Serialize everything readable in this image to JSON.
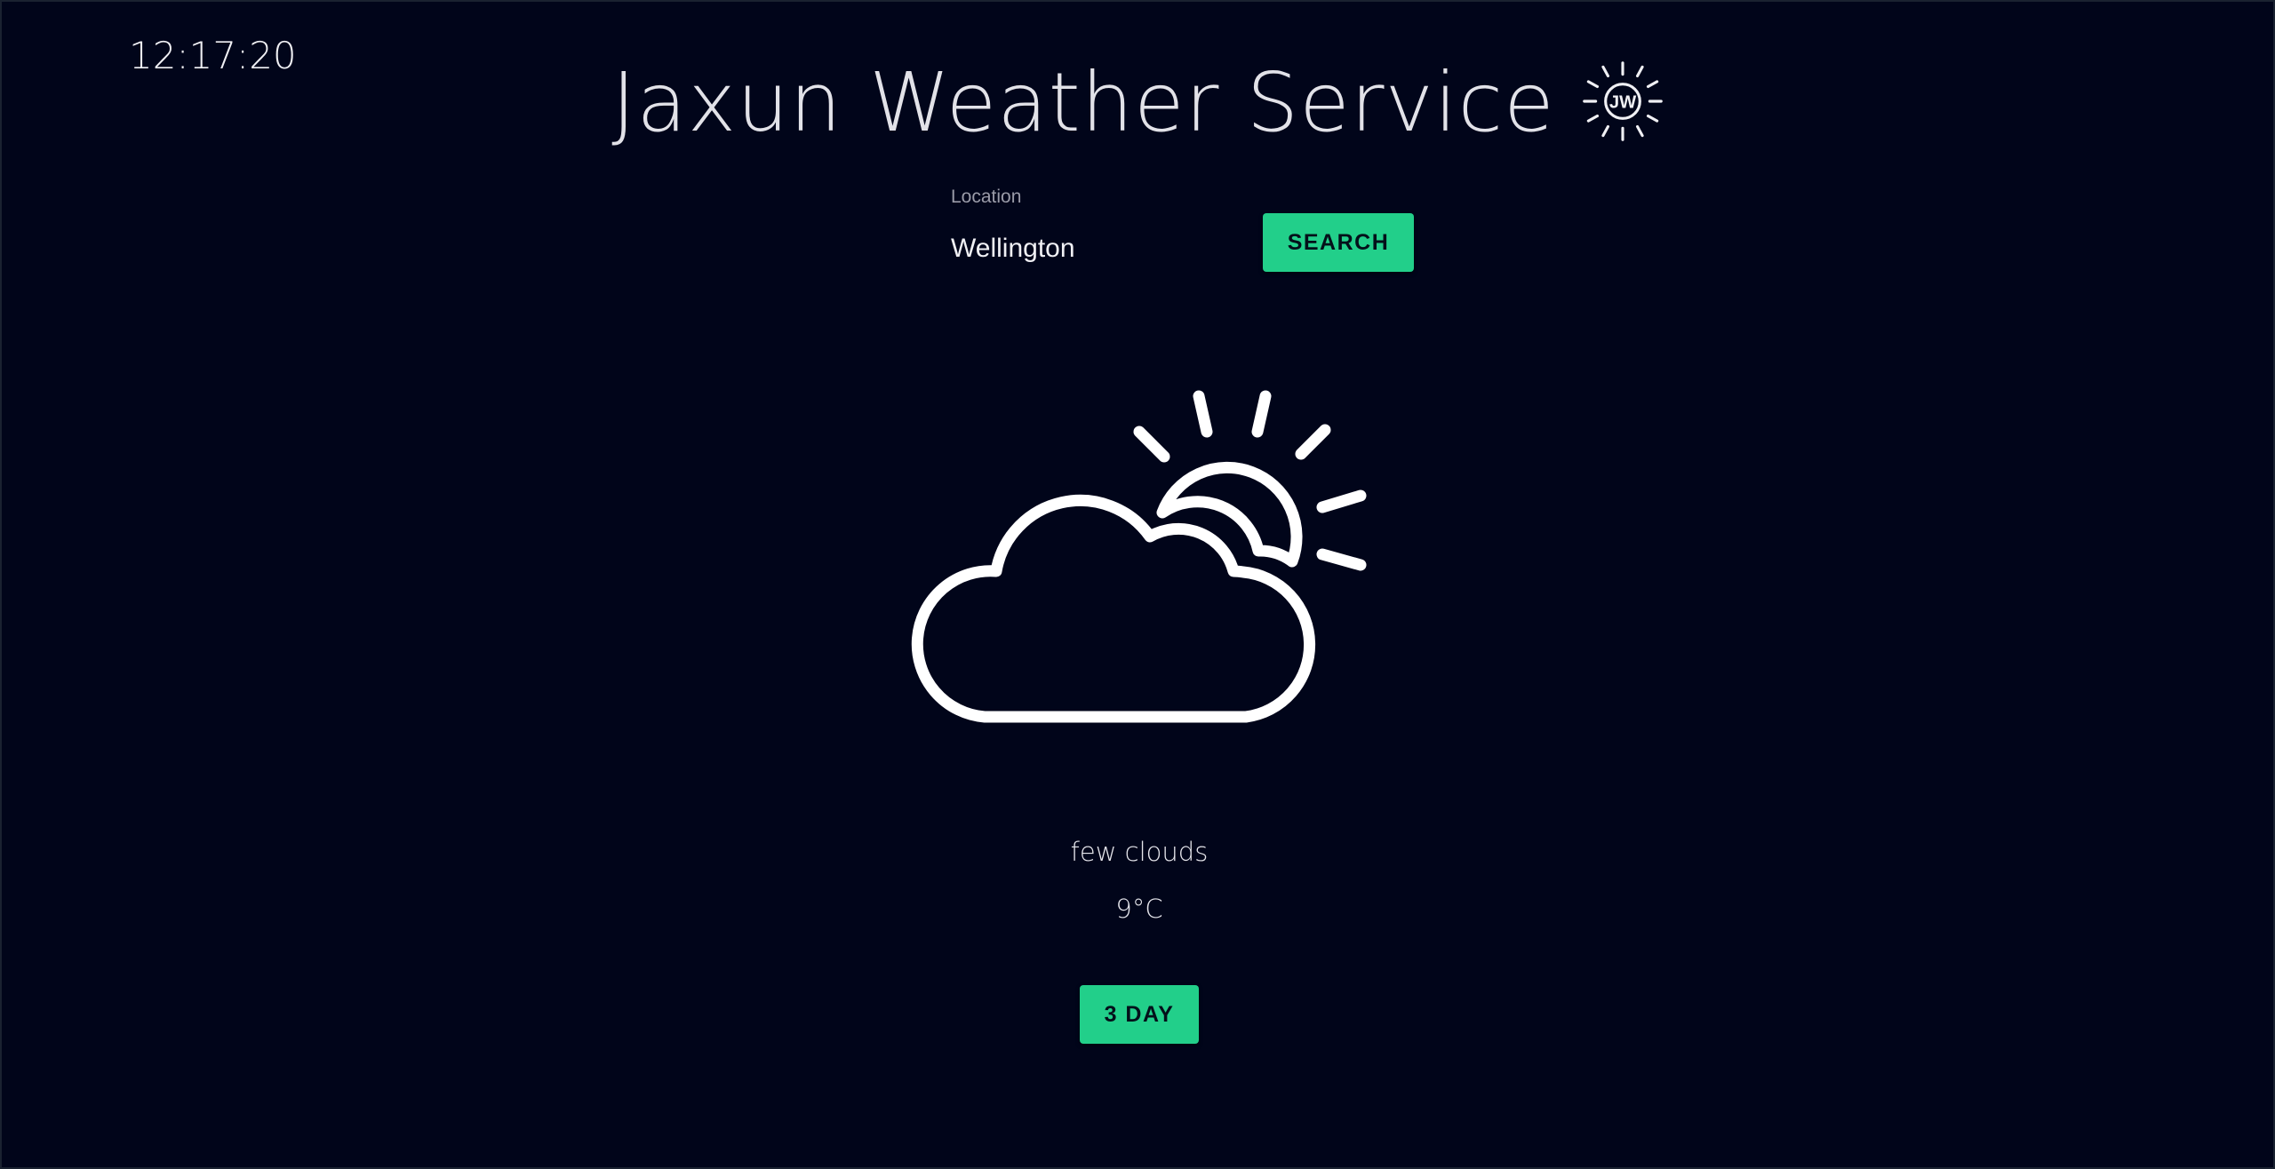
{
  "clock": {
    "time": "12:17:20"
  },
  "header": {
    "title": "Jaxun Weather Service",
    "logo_text": "JW",
    "logo_icon": "sun-logo-icon"
  },
  "search": {
    "label": "Location",
    "value": "Wellington",
    "button_label": "SEARCH"
  },
  "weather": {
    "icon": "partly-cloudy-icon",
    "description": "few clouds",
    "temperature": "9°C"
  },
  "forecast": {
    "button_label": "3 DAY"
  },
  "colors": {
    "background": "#01051a",
    "accent": "#22cf8a",
    "text": "#e6e6ec",
    "icon_stroke": "#ffffff"
  }
}
